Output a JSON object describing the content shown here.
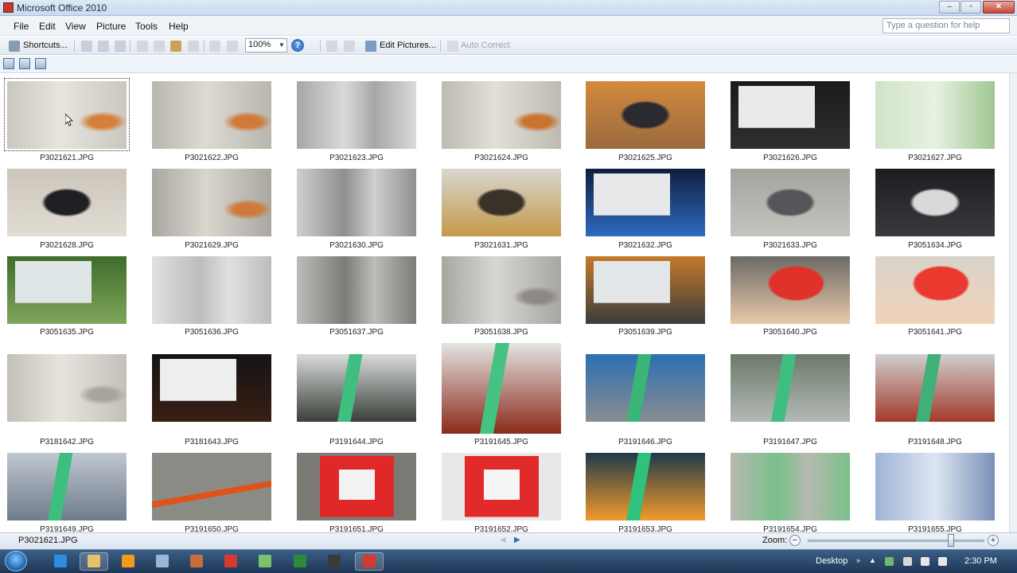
{
  "window": {
    "title": "Microsoft Office 2010",
    "minimize_glyph": "–",
    "maximize_glyph": "▫",
    "close_glyph": "✕"
  },
  "menu": {
    "items": [
      "File",
      "Edit",
      "View",
      "Picture",
      "Tools",
      "Help"
    ],
    "help_placeholder": "Type a question for help"
  },
  "toolbar": {
    "shortcuts_label": "Shortcuts...",
    "zoom_value": "100%",
    "edit_pictures_label": "Edit Pictures...",
    "auto_correct_label": "Auto Correct"
  },
  "thumbnails": [
    {
      "name": "P3021621.JPG",
      "kind": "pipe-marked",
      "colors": [
        "#c9c7bf",
        "#e6e4dc",
        "#d4803a"
      ],
      "selected": true
    },
    {
      "name": "P3021622.JPG",
      "kind": "pipe-marked",
      "colors": [
        "#b8b6ad",
        "#dcdad2",
        "#cf7a38"
      ]
    },
    {
      "name": "P3021623.JPG",
      "kind": "pipe-grey",
      "colors": [
        "#d9d9d9",
        "#a7a7a7",
        "#d23c3c"
      ]
    },
    {
      "name": "P3021624.JPG",
      "kind": "pipe-marked",
      "colors": [
        "#bdbab2",
        "#e2dfd7",
        "#c97330"
      ]
    },
    {
      "name": "P3021625.JPG",
      "kind": "dark-patch",
      "colors": [
        "#d48a3c",
        "#2a2a30",
        "#9a6a40"
      ]
    },
    {
      "name": "P3021626.JPG",
      "kind": "screen",
      "colors": [
        "#1b1b1b",
        "#e8ebe8",
        "#2f2f2f"
      ]
    },
    {
      "name": "P3021627.JPG",
      "kind": "green-label",
      "colors": [
        "#cfe3c6",
        "#e8f1e2",
        "#9fc792"
      ]
    },
    {
      "name": "P3021628.JPG",
      "kind": "dark-patch",
      "colors": [
        "#cbc5ba",
        "#1f1f24",
        "#e2ddd4"
      ]
    },
    {
      "name": "P3021629.JPG",
      "kind": "pipe-marked",
      "colors": [
        "#a9a7a0",
        "#d9d6ce",
        "#cf7a3a"
      ]
    },
    {
      "name": "P3021630.JPG",
      "kind": "pipe-grey",
      "colors": [
        "#8f8f8f",
        "#cfcfcf",
        "#6b6b6b"
      ]
    },
    {
      "name": "P3021631.JPG",
      "kind": "dark-patch",
      "colors": [
        "#d8d6cf",
        "#3a3228",
        "#c49a4a"
      ]
    },
    {
      "name": "P3021632.JPG",
      "kind": "screen",
      "colors": [
        "#0e1f3d",
        "#e6e8ea",
        "#2e6ac0"
      ]
    },
    {
      "name": "P3021633.JPG",
      "kind": "dark-patch",
      "colors": [
        "#a4a29c",
        "#56565a",
        "#c6c4be"
      ]
    },
    {
      "name": "P3051634.JPG",
      "kind": "dark-patch",
      "colors": [
        "#1d1d21",
        "#d9d9d9",
        "#3a3a3e"
      ]
    },
    {
      "name": "P3051635.JPG",
      "kind": "screen",
      "colors": [
        "#3f6b2c",
        "#dfe6e8",
        "#7fa65a"
      ]
    },
    {
      "name": "P3051636.JPG",
      "kind": "pipe-grey",
      "colors": [
        "#bdbdbd",
        "#e0e0e0",
        "#9a9a9a"
      ]
    },
    {
      "name": "P3051637.JPG",
      "kind": "pipe-grey",
      "colors": [
        "#7d7b78",
        "#bebcb8",
        "#5a5a5a"
      ]
    },
    {
      "name": "P3051638.JPG",
      "kind": "pipe-marked",
      "colors": [
        "#a8a6a0",
        "#d8d6d0",
        "#8d8a85"
      ]
    },
    {
      "name": "P3051639.JPG",
      "kind": "screen",
      "colors": [
        "#c57a2a",
        "#e3e6e8",
        "#3c3c3c"
      ]
    },
    {
      "name": "P3051640.JPG",
      "kind": "thermometer",
      "colors": [
        "#6c6a66",
        "#e0322b",
        "#e8c9a8"
      ]
    },
    {
      "name": "P3051641.JPG",
      "kind": "thermometer",
      "colors": [
        "#d9d3cc",
        "#ea3a2f",
        "#f0d3b6"
      ]
    },
    {
      "name": "P3181642.JPG",
      "kind": "pipe-marked",
      "colors": [
        "#c2c0b9",
        "#e6e4dd",
        "#a8a59e"
      ]
    },
    {
      "name": "P3181643.JPG",
      "kind": "screen",
      "colors": [
        "#141414",
        "#eeeeee",
        "#3a1f14"
      ]
    },
    {
      "name": "P3191644.JPG",
      "kind": "trench",
      "colors": [
        "#3fbf7f",
        "#d8dbd8",
        "#3a3f3a"
      ]
    },
    {
      "name": "P3191645.JPG",
      "kind": "trench",
      "colors": [
        "#44c383",
        "#e3e5e3",
        "#8a2a1a"
      ]
    },
    {
      "name": "P3191646.JPG",
      "kind": "trench",
      "colors": [
        "#3bb577",
        "#2b6fb2",
        "#8a8d90"
      ]
    },
    {
      "name": "P3191647.JPG",
      "kind": "trench",
      "colors": [
        "#3fbf7f",
        "#6d7a6a",
        "#b3b9b6"
      ]
    },
    {
      "name": "P3191648.JPG",
      "kind": "trench",
      "colors": [
        "#3fb07a",
        "#cfcfcf",
        "#a33a2a"
      ]
    },
    {
      "name": "P3191649.JPG",
      "kind": "trench",
      "colors": [
        "#3fbf7f",
        "#bfc7d1",
        "#6f7c8a"
      ]
    },
    {
      "name": "P3191650.JPG",
      "kind": "ground-tool",
      "colors": [
        "#8b8b86",
        "#e0521c",
        "#2a2a2a"
      ]
    },
    {
      "name": "P3191651.JPG",
      "kind": "red-case",
      "colors": [
        "#7c7a74",
        "#e02828",
        "#f2f2f2"
      ]
    },
    {
      "name": "P3191652.JPG",
      "kind": "red-case",
      "colors": [
        "#e8e8e8",
        "#e22a2a",
        "#f5f5f5"
      ]
    },
    {
      "name": "P3191653.JPG",
      "kind": "trench",
      "colors": [
        "#2fc27f",
        "#1f3a4a",
        "#f29a2a"
      ]
    },
    {
      "name": "P3191654.JPG",
      "kind": "pipe-grey",
      "colors": [
        "#7ac08a",
        "#b6b9b0",
        "#c23a2a"
      ]
    },
    {
      "name": "P3191655.JPG",
      "kind": "green-label",
      "colors": [
        "#9fb3d6",
        "#dde6f2",
        "#7a90b8"
      ]
    }
  ],
  "status": {
    "selected_file": "P3021621.JPG",
    "zoom_label": "Zoom:",
    "zoom_minus": "−",
    "zoom_plus": "+",
    "zoom_level_fraction": 0.81
  },
  "taskbar": {
    "desktop_label": "Desktop",
    "clock": "2:30 PM",
    "apps": [
      "ie-icon",
      "explorer-icon",
      "media-player-icon",
      "notepad-icon",
      "paint-icon",
      "acrobat-icon",
      "folder-sync-icon",
      "excel-icon",
      "app-c-icon",
      "picture-manager-icon"
    ]
  },
  "colors": {
    "accent": "#1d57b0",
    "taskbar": "#2a4a70"
  }
}
